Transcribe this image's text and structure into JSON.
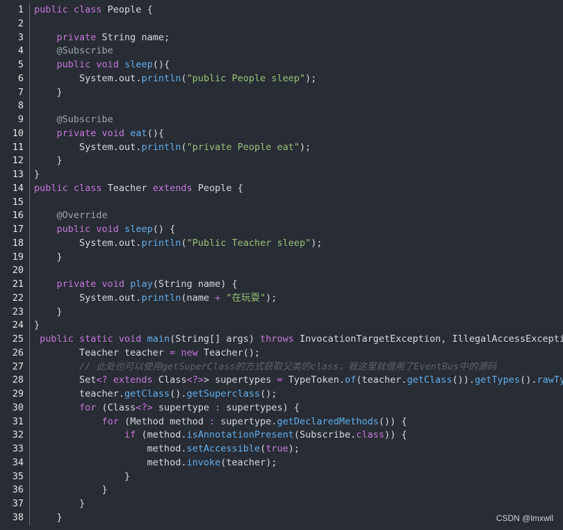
{
  "editor": {
    "lines": [
      {
        "n": "1",
        "parts": [
          [
            "k",
            "public class "
          ],
          [
            "t",
            "People {"
          ]
        ]
      },
      {
        "n": "2",
        "parts": []
      },
      {
        "n": "3",
        "parts": [
          [
            "t",
            "    "
          ],
          [
            "k",
            "private "
          ],
          [
            "t",
            "String name;"
          ]
        ]
      },
      {
        "n": "4",
        "parts": [
          [
            "t",
            "    "
          ],
          [
            "a",
            "@Subscribe"
          ]
        ]
      },
      {
        "n": "5",
        "parts": [
          [
            "t",
            "    "
          ],
          [
            "k",
            "public void "
          ],
          [
            "f",
            "sleep"
          ],
          [
            "t",
            "(){"
          ]
        ]
      },
      {
        "n": "6",
        "parts": [
          [
            "t",
            "        System.out."
          ],
          [
            "f",
            "println"
          ],
          [
            "t",
            "("
          ],
          [
            "s",
            "\"public People sleep\""
          ],
          [
            "t",
            ");"
          ]
        ]
      },
      {
        "n": "7",
        "parts": [
          [
            "t",
            "    }"
          ]
        ]
      },
      {
        "n": "8",
        "parts": []
      },
      {
        "n": "9",
        "parts": [
          [
            "t",
            "    "
          ],
          [
            "a",
            "@Subscribe"
          ]
        ]
      },
      {
        "n": "10",
        "parts": [
          [
            "t",
            "    "
          ],
          [
            "k",
            "private void "
          ],
          [
            "f",
            "eat"
          ],
          [
            "t",
            "(){"
          ]
        ]
      },
      {
        "n": "11",
        "parts": [
          [
            "t",
            "        System.out."
          ],
          [
            "f",
            "println"
          ],
          [
            "t",
            "("
          ],
          [
            "s",
            "\"private People eat\""
          ],
          [
            "t",
            ");"
          ]
        ]
      },
      {
        "n": "12",
        "parts": [
          [
            "t",
            "    }"
          ]
        ]
      },
      {
        "n": "13",
        "parts": [
          [
            "t",
            "}"
          ]
        ]
      },
      {
        "n": "14",
        "parts": [
          [
            "k",
            "public class "
          ],
          [
            "t",
            "Teacher "
          ],
          [
            "k",
            "extends "
          ],
          [
            "t",
            "People {"
          ]
        ]
      },
      {
        "n": "15",
        "parts": []
      },
      {
        "n": "16",
        "parts": [
          [
            "t",
            "    "
          ],
          [
            "a",
            "@Override"
          ]
        ]
      },
      {
        "n": "17",
        "parts": [
          [
            "t",
            "    "
          ],
          [
            "k",
            "public void "
          ],
          [
            "f",
            "sleep"
          ],
          [
            "t",
            "() {"
          ]
        ]
      },
      {
        "n": "18",
        "parts": [
          [
            "t",
            "        System.out."
          ],
          [
            "f",
            "println"
          ],
          [
            "t",
            "("
          ],
          [
            "s",
            "\"Public Teacher sleep\""
          ],
          [
            "t",
            ");"
          ]
        ]
      },
      {
        "n": "19",
        "parts": [
          [
            "t",
            "    }"
          ]
        ]
      },
      {
        "n": "20",
        "parts": []
      },
      {
        "n": "21",
        "parts": [
          [
            "t",
            "    "
          ],
          [
            "k",
            "private void "
          ],
          [
            "f",
            "play"
          ],
          [
            "t",
            "(String name) {"
          ]
        ]
      },
      {
        "n": "22",
        "parts": [
          [
            "t",
            "        System.out."
          ],
          [
            "f",
            "println"
          ],
          [
            "t",
            "(name "
          ],
          [
            "k",
            "+ "
          ],
          [
            "s",
            "\"在玩耍\""
          ],
          [
            "t",
            ");"
          ]
        ]
      },
      {
        "n": "23",
        "parts": [
          [
            "t",
            "    }"
          ]
        ]
      },
      {
        "n": "24",
        "parts": [
          [
            "t",
            "}"
          ]
        ]
      },
      {
        "n": "25",
        "parts": [
          [
            "t",
            " "
          ],
          [
            "k",
            "public static void "
          ],
          [
            "f",
            "main"
          ],
          [
            "t",
            "(String[] args) "
          ],
          [
            "k",
            "throws "
          ],
          [
            "t",
            "InvocationTargetException, IllegalAccessException {"
          ]
        ]
      },
      {
        "n": "26",
        "parts": [
          [
            "t",
            "        Teacher teacher "
          ],
          [
            "k",
            "= new "
          ],
          [
            "t",
            "Teacher();"
          ]
        ]
      },
      {
        "n": "27",
        "parts": [
          [
            "t",
            "        "
          ],
          [
            "c",
            "// 此处也可以使用getSuperClass的方式获取父类的class，我这里就借用了EventBus中的源码"
          ]
        ]
      },
      {
        "n": "28",
        "parts": [
          [
            "t",
            "        Set"
          ],
          [
            "k",
            "<? extends "
          ],
          [
            "t",
            "Class"
          ],
          [
            "k",
            "<?>"
          ],
          [
            "t",
            "> supertypes "
          ],
          [
            "k",
            "= "
          ],
          [
            "t",
            "TypeToken."
          ],
          [
            "f",
            "of"
          ],
          [
            "t",
            "(teacher."
          ],
          [
            "f",
            "getClass"
          ],
          [
            "t",
            "())."
          ],
          [
            "f",
            "getTypes"
          ],
          [
            "t",
            "()."
          ],
          [
            "f",
            "rawTypes"
          ],
          [
            "t",
            "();"
          ]
        ]
      },
      {
        "n": "29",
        "parts": [
          [
            "t",
            "        teacher."
          ],
          [
            "f",
            "getClass"
          ],
          [
            "t",
            "()."
          ],
          [
            "f",
            "getSuperclass"
          ],
          [
            "t",
            "();"
          ]
        ]
      },
      {
        "n": "30",
        "parts": [
          [
            "t",
            "        "
          ],
          [
            "k",
            "for "
          ],
          [
            "t",
            "(Class"
          ],
          [
            "k",
            "<?> "
          ],
          [
            "t",
            "supertype "
          ],
          [
            "k",
            ": "
          ],
          [
            "t",
            "supertypes) {"
          ]
        ]
      },
      {
        "n": "31",
        "parts": [
          [
            "t",
            "            "
          ],
          [
            "k",
            "for "
          ],
          [
            "t",
            "(Method method "
          ],
          [
            "k",
            ": "
          ],
          [
            "t",
            "supertype."
          ],
          [
            "f",
            "getDeclaredMethods"
          ],
          [
            "t",
            "()) {"
          ]
        ]
      },
      {
        "n": "32",
        "parts": [
          [
            "t",
            "                "
          ],
          [
            "k",
            "if "
          ],
          [
            "t",
            "(method."
          ],
          [
            "f",
            "isAnnotationPresent"
          ],
          [
            "t",
            "(Subscribe."
          ],
          [
            "k",
            "class"
          ],
          [
            "t",
            ")) {"
          ]
        ]
      },
      {
        "n": "33",
        "parts": [
          [
            "t",
            "                    method."
          ],
          [
            "f",
            "setAccessible"
          ],
          [
            "t",
            "("
          ],
          [
            "k",
            "true"
          ],
          [
            "t",
            ");"
          ]
        ]
      },
      {
        "n": "34",
        "parts": [
          [
            "t",
            "                    method."
          ],
          [
            "f",
            "invoke"
          ],
          [
            "t",
            "(teacher);"
          ]
        ]
      },
      {
        "n": "35",
        "parts": [
          [
            "t",
            "                }"
          ]
        ]
      },
      {
        "n": "36",
        "parts": [
          [
            "t",
            "            }"
          ]
        ]
      },
      {
        "n": "37",
        "parts": [
          [
            "t",
            "        }"
          ]
        ]
      },
      {
        "n": "38",
        "parts": [
          [
            "t",
            "    }"
          ]
        ]
      }
    ]
  },
  "watermark": "CSDN @lmxwll",
  "colors": {
    "background": "#282c34",
    "keyword": "#c678dd",
    "function": "#61afef",
    "string": "#98c379",
    "annotation": "#9da5b4",
    "comment": "#5c6370"
  }
}
